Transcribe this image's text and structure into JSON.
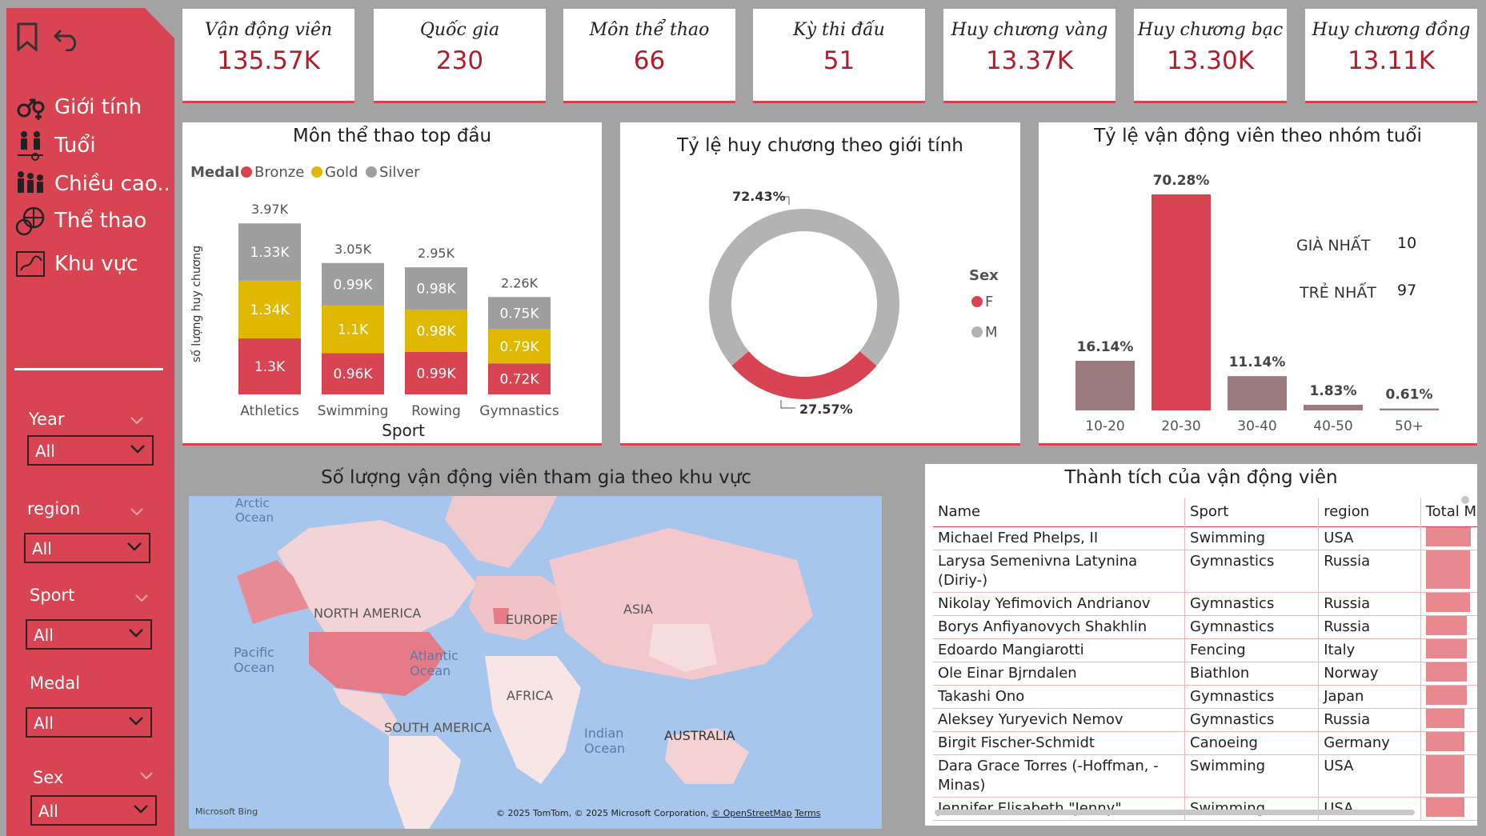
{
  "sidebar": {
    "nav": [
      "Giới tính",
      "Tuổi",
      "Chiều cao..",
      "Thể thao",
      "Khu vực"
    ],
    "filters": [
      {
        "label": "Year",
        "value": "All"
      },
      {
        "label": "region",
        "value": "All"
      },
      {
        "label": "Sport",
        "value": "All"
      },
      {
        "label": "Medal",
        "value": "All"
      },
      {
        "label": "Sex",
        "value": "All"
      }
    ]
  },
  "cards": [
    {
      "title": "Vận động viên",
      "value": "135.57K"
    },
    {
      "title": "Quốc gia",
      "value": "230"
    },
    {
      "title": "Môn thể thao",
      "value": "66"
    },
    {
      "title": "Kỳ thi đấu",
      "value": "51"
    },
    {
      "title": "Huy chương vàng",
      "value": "13.37K"
    },
    {
      "title": "Huy chương bạc",
      "value": "13.30K"
    },
    {
      "title": "Huy chương đồng",
      "value": "13.11K"
    }
  ],
  "colors": {
    "bronze": "#d94452",
    "gold": "#e1b800",
    "silver": "#9e9e9e",
    "male_donut": "#b3b3b3",
    "age_other": "#9b7b7d"
  },
  "chart_data": [
    {
      "type": "bar",
      "stacked": true,
      "title": "Môn thể thao top đầu",
      "xlabel": "Sport",
      "ylabel": "số lượng huy chương",
      "legend_title": "Medal",
      "categories": [
        "Athletics",
        "Swimming",
        "Rowing",
        "Gymnastics"
      ],
      "series": [
        {
          "name": "Bronze",
          "values": [
            1300,
            960,
            990,
            720
          ],
          "labels": [
            "1.3K",
            "0.96K",
            "0.99K",
            "0.72K"
          ]
        },
        {
          "name": "Gold",
          "values": [
            1340,
            1100,
            980,
            790
          ],
          "labels": [
            "1.34K",
            "1.1K",
            "0.98K",
            "0.79K"
          ]
        },
        {
          "name": "Silver",
          "values": [
            1330,
            990,
            980,
            750
          ],
          "labels": [
            "1.33K",
            "0.99K",
            "0.98K",
            "0.75K"
          ]
        }
      ],
      "totals": [
        "3.97K",
        "3.05K",
        "2.95K",
        "2.26K"
      ]
    },
    {
      "type": "pie",
      "donut": true,
      "title": "Tỷ lệ huy chương theo giới tính",
      "legend_title": "Sex",
      "labels": [
        "F",
        "M"
      ],
      "values": [
        27.57,
        72.43
      ],
      "value_labels": [
        "27.57%",
        "72.43%"
      ]
    },
    {
      "type": "bar",
      "title": "Tỷ lệ vận động viên theo nhóm tuổi",
      "categories": [
        "10-20",
        "20-30",
        "30-40",
        "40-50",
        "50+"
      ],
      "values": [
        16.14,
        70.28,
        11.14,
        1.83,
        0.61
      ],
      "value_labels": [
        "16.14%",
        "70.28%",
        "11.14%",
        "1.83%",
        "0.61%"
      ]
    }
  ],
  "age_stats": {
    "oldest_label": "GIÀ NHẤT",
    "oldest_value": "10",
    "youngest_label": "TRẺ NHẤT",
    "youngest_value": "97"
  },
  "map": {
    "title": "Số lượng vận động viên tham gia theo khu vực",
    "labels": {
      "arctic": "Arctic Ocean",
      "na": "NORTH AMERICA",
      "europe": "EUROPE",
      "asia": "ASIA",
      "pacific": "Pacific Ocean",
      "atlantic": "Atlantic Ocean",
      "africa": "AFRICA",
      "sa": "SOUTH AMERICA",
      "indian": "Indian Ocean",
      "australia": "AUSTRALIA"
    },
    "attribution": "© 2025 TomTom, © 2025 Microsoft Corporation,",
    "osm": "© OpenStreetMap",
    "terms": "Terms",
    "brand": "Microsoft Bing"
  },
  "table": {
    "title": "Thành tích của vận động viên",
    "headers": [
      "Name",
      "Sport",
      "region",
      "Total M"
    ],
    "rows": [
      {
        "name": "Michael Fred Phelps, II",
        "sport": "Swimming",
        "region": "USA",
        "total": 1.0
      },
      {
        "name": "Larysa Semenivna Latynina (Diriy-)",
        "sport": "Gymnastics",
        "region": "Russia",
        "total": 0.99
      },
      {
        "name": "Nikolay Yefimovich Andrianov",
        "sport": "Gymnastics",
        "region": "Russia",
        "total": 0.98
      },
      {
        "name": "Borys Anfiyanovych Shakhlin",
        "sport": "Gymnastics",
        "region": "Russia",
        "total": 0.92
      },
      {
        "name": "Edoardo Mangiarotti",
        "sport": "Fencing",
        "region": "Italy",
        "total": 0.92
      },
      {
        "name": "Ole Einar Bjrndalen",
        "sport": "Biathlon",
        "region": "Norway",
        "total": 0.92
      },
      {
        "name": "Takashi Ono",
        "sport": "Gymnastics",
        "region": "Japan",
        "total": 0.92
      },
      {
        "name": "Aleksey Yuryevich Nemov",
        "sport": "Gymnastics",
        "region": "Russia",
        "total": 0.86
      },
      {
        "name": "Birgit Fischer-Schmidt",
        "sport": "Canoeing",
        "region": "Germany",
        "total": 0.86
      },
      {
        "name": "Dara Grace Torres (-Hoffman, -Minas)",
        "sport": "Swimming",
        "region": "USA",
        "total": 0.86
      },
      {
        "name": "Jennifer Elisabeth \"Jenny\"",
        "sport": "Swimming",
        "region": "USA",
        "total": 0.86
      }
    ]
  }
}
